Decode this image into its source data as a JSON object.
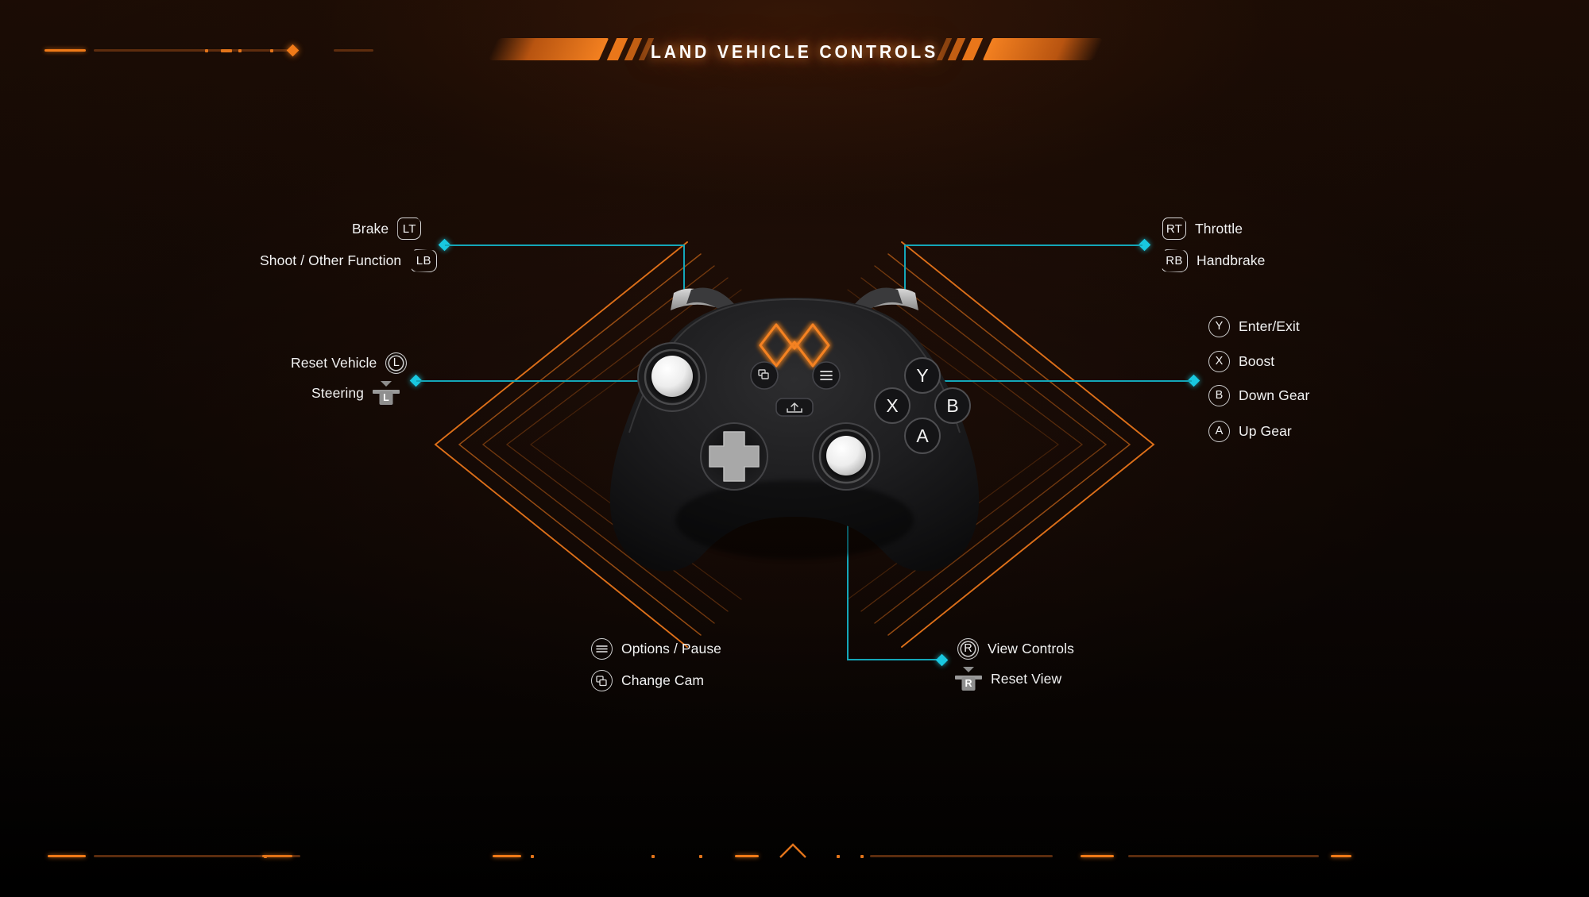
{
  "screen": {
    "title": "LAND VEHICLE CONTROLS",
    "accent_orange": "#f07a18",
    "accent_cyan": "#19c8e0",
    "background": "#140a06"
  },
  "controller": {
    "device": "gamepad",
    "logo": "orange-w-logo",
    "face_buttons": [
      "Y",
      "X",
      "B",
      "A"
    ],
    "center_buttons": [
      "change-cam-icon",
      "options-icon",
      "share-icon"
    ]
  },
  "mappings": {
    "top_left": [
      {
        "label": "Brake",
        "button": "LT",
        "badge": "trigger"
      },
      {
        "label": "Shoot / Other Function",
        "button": "LB",
        "badge": "bumper"
      }
    ],
    "top_right": [
      {
        "label": "Throttle",
        "button": "RT",
        "badge": "trigger"
      },
      {
        "label": "Handbrake",
        "button": "RB",
        "badge": "bumper"
      }
    ],
    "mid_left": [
      {
        "label": "Reset Vehicle",
        "button": "L",
        "badge": "stick-press"
      },
      {
        "label": "Steering",
        "button": "L",
        "badge": "stick-move"
      }
    ],
    "mid_right": [
      {
        "label": "Enter/Exit",
        "button": "Y",
        "badge": "face"
      },
      {
        "label": "Boost",
        "button": "X",
        "badge": "face"
      },
      {
        "label": "Down Gear",
        "button": "B",
        "badge": "face"
      },
      {
        "label": "Up Gear",
        "button": "A",
        "badge": "face"
      }
    ],
    "bottom_left": [
      {
        "label": "Options / Pause",
        "button": "options-icon",
        "badge": "icon"
      },
      {
        "label": "Change Cam",
        "button": "change-cam-icon",
        "badge": "icon"
      }
    ],
    "bottom_right": [
      {
        "label": "View Controls",
        "button": "R",
        "badge": "stick-press"
      },
      {
        "label": "Reset View",
        "button": "R",
        "badge": "stick-move"
      }
    ]
  }
}
